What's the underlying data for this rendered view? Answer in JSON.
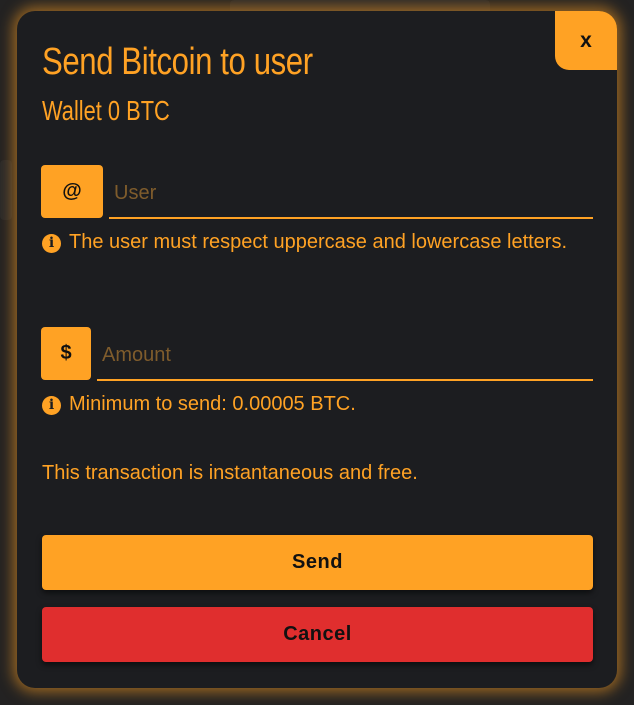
{
  "modal": {
    "close_label": "x",
    "title": "Send Bitcoin to user",
    "wallet": "Wallet 0 BTC",
    "user_field": {
      "addon": "@",
      "placeholder": "User",
      "value": "",
      "hint": "The user must respect uppercase and lowercase letters."
    },
    "amount_field": {
      "addon": "$",
      "placeholder": "Amount",
      "value": "",
      "hint": "Minimum to send: 0.00005 BTC."
    },
    "note": "This transaction is instantaneous and free.",
    "send_label": "Send",
    "cancel_label": "Cancel"
  },
  "icons": {
    "info": "info-circle-icon",
    "info_glyph": "i"
  },
  "colors": {
    "accent": "#ffa224",
    "danger": "#e02e2e",
    "modal_bg": "#1c1d20"
  }
}
